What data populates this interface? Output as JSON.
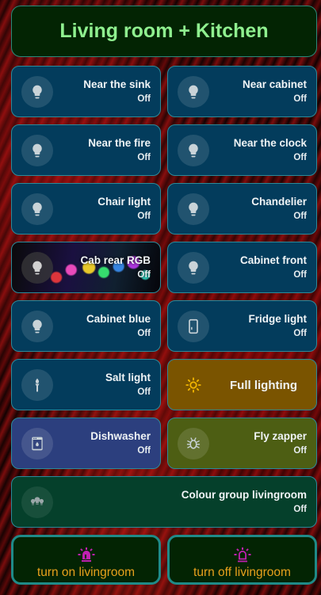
{
  "title": "Living room + Kitchen",
  "tiles": [
    {
      "name": "Near the sink",
      "state": "Off",
      "icon": "lightbulb-icon"
    },
    {
      "name": "Near cabinet",
      "state": "Off",
      "icon": "lightbulb-icon"
    },
    {
      "name": "Near the fire",
      "state": "Off",
      "icon": "lightbulb-icon"
    },
    {
      "name": "Near the clock",
      "state": "Off",
      "icon": "lightbulb-icon"
    },
    {
      "name": "Chair light",
      "state": "Off",
      "icon": "lightbulb-icon"
    },
    {
      "name": "Chandelier",
      "state": "Off",
      "icon": "lightbulb-icon"
    },
    {
      "name": "Cab rear RGB",
      "state": "Off",
      "icon": "lightbulb-icon"
    },
    {
      "name": "Cabinet front",
      "state": "Off",
      "icon": "lightbulb-icon"
    },
    {
      "name": "Cabinet blue",
      "state": "Off",
      "icon": "lightbulb-icon"
    },
    {
      "name": "Fridge light",
      "state": "Off",
      "icon": "fridge-icon"
    },
    {
      "name": "Salt light",
      "state": "Off",
      "icon": "torch-icon"
    },
    {
      "name": "Full lighting",
      "icon": "sun-icon"
    },
    {
      "name": "Dishwasher",
      "state": "Off",
      "icon": "dishwasher-icon"
    },
    {
      "name": "Fly zapper",
      "state": "Off",
      "icon": "bug-icon"
    },
    {
      "name": "Colour group livingroom",
      "state": "Off",
      "icon": "lightbulb-group-icon"
    }
  ],
  "buttons": {
    "on": {
      "label": "turn on livingroom",
      "icon": "alarm-light-icon"
    },
    "off": {
      "label": "turn off livingroom",
      "icon": "alarm-light-outline-icon"
    }
  },
  "colors": {
    "tile_blue": "#033c5c",
    "title_text": "#8ff08f",
    "button_text": "#e8a11c",
    "button_icon": "#c020b0",
    "sun_icon": "#f0b400"
  }
}
